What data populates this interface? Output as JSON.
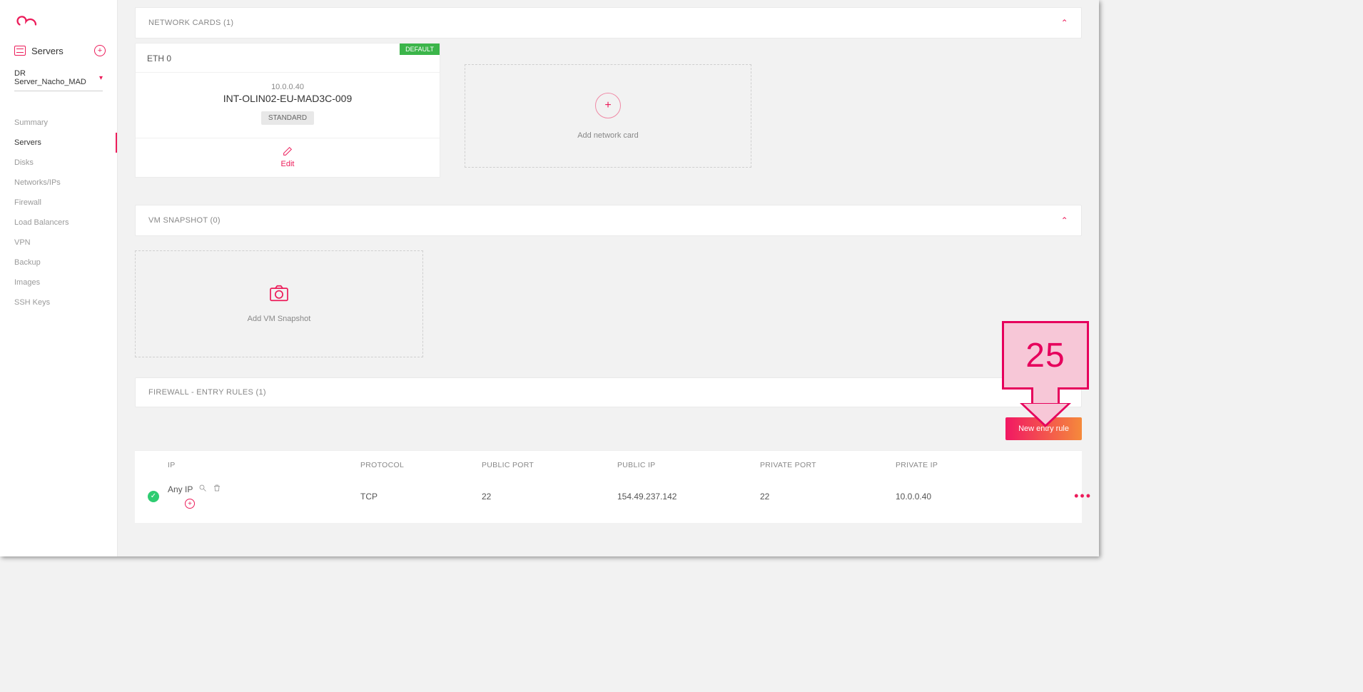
{
  "sidebar": {
    "title": "Servers",
    "selected_server": "DR Server_Nacho_MAD",
    "nav": [
      {
        "label": "Summary",
        "active": false
      },
      {
        "label": "Servers",
        "active": true
      },
      {
        "label": "Disks",
        "active": false
      },
      {
        "label": "Networks/IPs",
        "active": false
      },
      {
        "label": "Firewall",
        "active": false
      },
      {
        "label": "Load Balancers",
        "active": false
      },
      {
        "label": "VPN",
        "active": false
      },
      {
        "label": "Backup",
        "active": false
      },
      {
        "label": "Images",
        "active": false
      },
      {
        "label": "SSH Keys",
        "active": false
      }
    ]
  },
  "network_cards": {
    "header": "NETWORK CARDS (1)",
    "eth_label": "ETH 0",
    "default_badge": "DEFAULT",
    "ip": "10.0.0.40",
    "name": "INT-OLIN02-EU-MAD3C-009",
    "type_pill": "STANDARD",
    "edit_label": "Edit",
    "add_label": "Add network card"
  },
  "vm_snapshot": {
    "header": "VM SNAPSHOT (0)",
    "add_label": "Add VM Snapshot"
  },
  "firewall": {
    "header": "FIREWALL - ENTRY RULES (1)",
    "new_rule_button": "New entry rule",
    "columns": {
      "ip": "IP",
      "protocol": "PROTOCOL",
      "public_port": "PUBLIC PORT",
      "public_ip": "PUBLIC IP",
      "private_port": "PRIVATE PORT",
      "private_ip": "PRIVATE IP"
    },
    "row": {
      "ip_label": "Any IP",
      "protocol": "TCP",
      "public_port": "22",
      "public_ip": "154.49.237.142",
      "private_port": "22",
      "private_ip": "10.0.0.40"
    }
  },
  "callout": {
    "number": "25"
  }
}
